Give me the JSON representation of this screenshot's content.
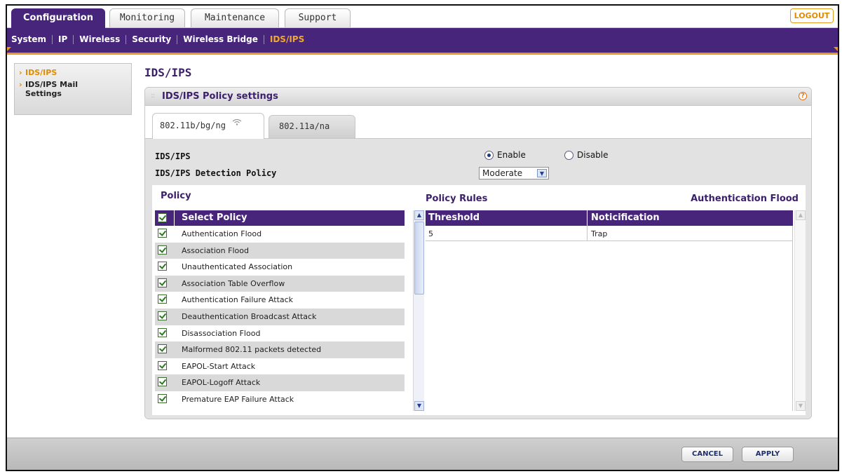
{
  "top_tabs": [
    {
      "label": "Configuration",
      "active": true
    },
    {
      "label": "Monitoring",
      "active": false
    },
    {
      "label": "Maintenance",
      "active": false
    },
    {
      "label": "Support",
      "active": false
    }
  ],
  "logout_label": "LOGOUT",
  "subnav": [
    {
      "label": "System",
      "active": false
    },
    {
      "label": "IP",
      "active": false
    },
    {
      "label": "Wireless",
      "active": false
    },
    {
      "label": "Security",
      "active": false
    },
    {
      "label": "Wireless Bridge",
      "active": false
    },
    {
      "label": "IDS/IPS",
      "active": true
    }
  ],
  "left_menu": [
    {
      "label": "IDS/IPS",
      "active": true
    },
    {
      "label": "IDS/IPS Mail Settings",
      "active": false
    }
  ],
  "page_title": "IDS/IPS",
  "panel": {
    "title": "IDS/IPS Policy settings",
    "help_icon": "?"
  },
  "radio_tabs": [
    {
      "label": "802.11b/bg/ng",
      "active": true,
      "icon": "wifi-icon"
    },
    {
      "label": "802.11a/na",
      "active": false
    }
  ],
  "form": {
    "ids_label": "IDS/IPS",
    "enable_label": "Enable",
    "disable_label": "Disable",
    "enabled": true,
    "detection_label": "IDS/IPS Detection Policy",
    "detection_value": "Moderate"
  },
  "policy_section": {
    "heading": "Policy",
    "column_header": "Select Policy",
    "rows": [
      "Authentication Flood",
      "Association Flood",
      "Unauthenticated Association",
      "Association Table Overflow",
      "Authentication Failure Attack",
      "Deauthentication Broadcast Attack",
      "Disassociation Flood",
      "Malformed 802.11 packets detected",
      "EAPOL-Start Attack",
      "EAPOL-Logoff Attack",
      "Premature EAP Failure Attack"
    ]
  },
  "rules_section": {
    "heading": "Policy Rules",
    "selected_policy": "Authentication Flood",
    "columns": [
      "Threshold",
      "Noticification"
    ],
    "rows": [
      [
        "5",
        "Trap"
      ]
    ]
  },
  "footer": {
    "cancel_label": "CANCEL",
    "apply_label": "APPLY"
  },
  "colors": {
    "purple": "#47257a",
    "orange": "#e89a1c",
    "title_purple": "#3b1f6b"
  }
}
